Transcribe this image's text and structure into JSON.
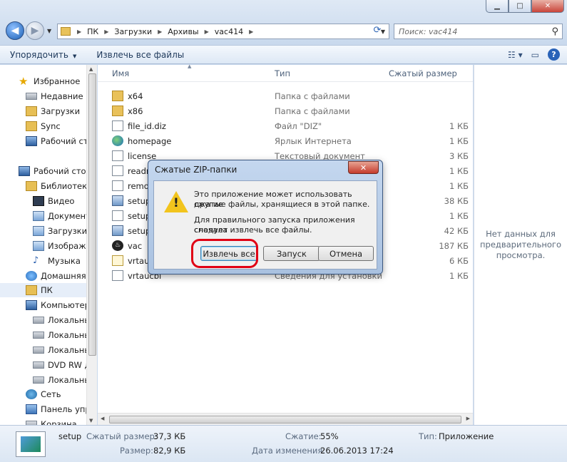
{
  "window": {
    "minimize": "▁",
    "maximize": "□",
    "close": "✕"
  },
  "address": {
    "crumbs": [
      "ПК",
      "Загрузки",
      "Архивы",
      "vac414"
    ]
  },
  "search": {
    "placeholder": "Поиск: vac414"
  },
  "toolbar": {
    "organize": "Упорядочить",
    "extract_all": "Извлечь все файлы"
  },
  "sidebar": {
    "items": [
      {
        "label": "Избранное",
        "icon": "star-icon"
      },
      {
        "label": "Недавние м",
        "icon": "recent-places-icon"
      },
      {
        "label": "Загрузки",
        "icon": "folder-icon"
      },
      {
        "label": "Sync",
        "icon": "folder-icon"
      },
      {
        "label": "Рабочий ст",
        "icon": "desktop-icon"
      },
      {
        "label": "Рабочий стол",
        "icon": "desktop-icon"
      },
      {
        "label": "Библиотеки",
        "icon": "libraries-icon"
      },
      {
        "label": "Видео",
        "icon": "video-icon"
      },
      {
        "label": "Документ",
        "icon": "documents-icon"
      },
      {
        "label": "Загрузки",
        "icon": "downloads-icon"
      },
      {
        "label": "Изображе",
        "icon": "pictures-icon"
      },
      {
        "label": "Музыка",
        "icon": "music-icon"
      },
      {
        "label": "Домашняя",
        "icon": "homegroup-icon"
      },
      {
        "label": "ПК",
        "icon": "folder-icon"
      },
      {
        "label": "Компьютер",
        "icon": "computer-icon"
      },
      {
        "label": "Локальны",
        "icon": "drive-icon"
      },
      {
        "label": "Локальны",
        "icon": "drive-icon"
      },
      {
        "label": "Локальны",
        "icon": "drive-icon"
      },
      {
        "label": "DVD RW д",
        "icon": "dvd-icon"
      },
      {
        "label": "Локальны",
        "icon": "drive-icon"
      },
      {
        "label": "Сеть",
        "icon": "network-icon"
      },
      {
        "label": "Панель упр",
        "icon": "control-panel-icon"
      },
      {
        "label": "Корзина",
        "icon": "recycle-bin-icon"
      }
    ]
  },
  "columns": {
    "name": "Имя",
    "type": "Тип",
    "size": "Сжатый размер"
  },
  "files": [
    {
      "name": "x64",
      "type": "Папка с файлами",
      "size": ""
    },
    {
      "name": "x86",
      "type": "Папка с файлами",
      "size": ""
    },
    {
      "name": "file_id.diz",
      "type": "Файл \"DIZ\"",
      "size": "1 КБ"
    },
    {
      "name": "homepage",
      "type": "Ярлык Интернета",
      "size": "1 КБ"
    },
    {
      "name": "license",
      "type": "Текстовый документ",
      "size": "3 КБ"
    },
    {
      "name": "readm",
      "type": "",
      "size": "1 КБ"
    },
    {
      "name": "remov",
      "type": "",
      "size": "1 КБ"
    },
    {
      "name": "setup",
      "type": "",
      "size": "38 КБ"
    },
    {
      "name": "setup",
      "type": "",
      "size": "1 КБ"
    },
    {
      "name": "setup",
      "type": "",
      "size": "42 КБ"
    },
    {
      "name": "vac",
      "type": "",
      "size": "187 КБ"
    },
    {
      "name": "vrtauc",
      "type": "",
      "size": "6 КБ"
    },
    {
      "name": "vrtaucbl",
      "type": "Сведения для установки",
      "size": "1 КБ"
    }
  ],
  "preview": {
    "text": "Нет данных для предварительного просмотра."
  },
  "details": {
    "name": "setup",
    "compressed_label": "Сжатый размер:",
    "compressed_value": "37,3 КБ",
    "size_label": "Размер:",
    "size_value": "82,9 КБ",
    "compression_label": "Сжатие:",
    "compression_value": "55%",
    "modified_label": "Дата изменения:",
    "modified_value": "26.06.2013 17:24",
    "type_label": "Тип:",
    "type_value": "Приложение"
  },
  "dialog": {
    "title": "Сжатые ZIP-папки",
    "close": "✕",
    "line1": "Это приложение может использовать другие",
    "line2": "сжатые файлы, хранящиеся в этой папке.",
    "line3": "Для правильного запуска приложения следует",
    "line4": "сначала извлечь все файлы.",
    "extract": "Извлечь все",
    "run": "Запуск",
    "cancel": "Отмена"
  },
  "colors": {
    "highlight": "#e00014",
    "accent": "#2a63b8"
  }
}
